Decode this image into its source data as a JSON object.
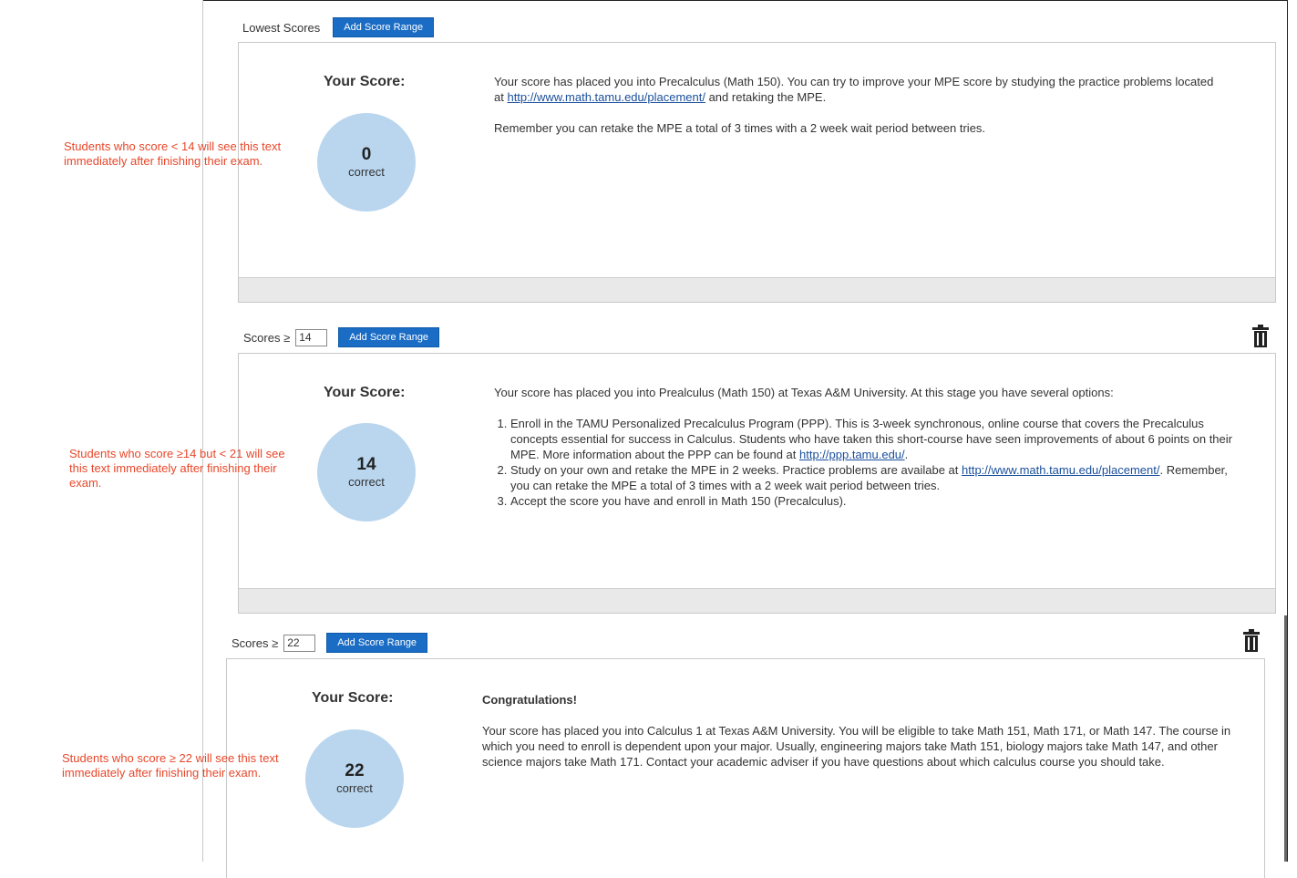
{
  "sections": [
    {
      "header_label": "Lowest Scores",
      "add_button": "Add Score Range",
      "your_score_label": "Your Score:",
      "score": "0",
      "score_sub": "correct",
      "text_p1_a": "Your score has placed you into Precalculus (Math 150).  You can try to improve your MPE score by studying the practice problems located at ",
      "text_p1_link": "http://www.math.tamu.edu/placement/",
      "text_p1_b": " and retaking the MPE.",
      "text_p2": "Remember you can retake the MPE a total of 3 times with a 2 week wait period between tries.",
      "note": "Students who score < 14 will see this text immediately after finishing their exam."
    },
    {
      "header_label": "Scores ≥",
      "input_value": "14",
      "add_button": "Add Score Range",
      "trash_icon": "trash-icon",
      "your_score_label": "Your Score:",
      "score": "14",
      "score_sub": "correct",
      "intro": "Your score has placed you into Prealculus (Math 150) at Texas A&M University.  At this stage you have several options:",
      "item1_a": "Enroll in the TAMU Personalized Precalculus Program (PPP).  This is 3-week synchronous, online course that covers the Precalculus concepts essential for success in Calculus.  Students who have taken this short-course have seen improvements of about 6 points on their MPE.  More information about the PPP can be found at ",
      "item1_link": "http://ppp.tamu.edu/",
      "item1_b": ".",
      "item2_a": "Study on your own and retake the MPE in 2 weeks.  Practice problems are availabe at ",
      "item2_link": "http://www.math.tamu.edu/placement/",
      "item2_b": ".  Remember, you can retake the MPE a total of 3 times with a 2 week wait period between tries.",
      "item3": "Accept the score you have and enroll in Math 150 (Precalculus).",
      "note": "Students who score ≥14 but < 21 will see this text immediately after finishing their exam."
    },
    {
      "header_label": "Scores ≥",
      "input_value": "22",
      "add_button": "Add Score Range",
      "trash_icon": "trash-icon",
      "your_score_label": "Your Score:",
      "score": "22",
      "score_sub": "correct",
      "heading": "Congratulations!",
      "text": "Your score has placed you into Calculus 1 at Texas A&M University.  You will be eligible to take Math 151, Math 171, or Math 147.  The course in which you need to enroll is dependent upon your major.  Usually, engineering majors take Math 151, biology majors take Math 147, and other science majors take Math 171.  Contact your academic adviser if you have questions about which calculus course you should take.",
      "note": "Students who score ≥ 22 will see this text immediately after finishing their exam."
    }
  ],
  "colors": {
    "button": "#1a6cc4",
    "circle": "#b9d6ee",
    "note": "#e8472a"
  }
}
